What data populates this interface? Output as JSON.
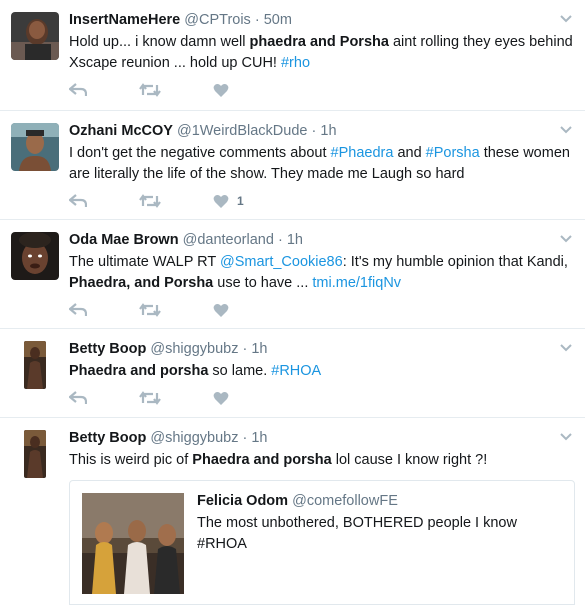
{
  "colors": {
    "link": "#1b95e0",
    "muted": "#657786",
    "text": "#14171a",
    "icon": "#aab8c2",
    "divider": "#e6ecf0"
  },
  "tweets": [
    {
      "name": "InsertNameHere",
      "handle": "@CPTrois",
      "sep": "·",
      "time": "50m",
      "text": {
        "a": "Hold up... i know damn well ",
        "b1": "phaedra and Porsha",
        "c": " aint rolling they eyes behind Xscape reunion ... hold up CUH! ",
        "tag": "#rho"
      },
      "like_count": ""
    },
    {
      "name": "Ozhani McCOY",
      "handle": "@1WeirdBlackDude",
      "sep": "·",
      "time": "1h",
      "text": {
        "a": "I don't get the negative comments about ",
        "tag1": "#Phaedra",
        "b": " and ",
        "tag2": "#Porsha",
        "c": " these women are literally the life of the show. They made me Laugh so hard"
      },
      "like_count": "1"
    },
    {
      "name": "Oda Mae Brown",
      "handle": "@danteorland",
      "sep": "·",
      "time": "1h",
      "text": {
        "a": "The ultimate WALP RT ",
        "mention": "@Smart_Cookie86",
        "b": ": It's my humble opinion that Kandi, ",
        "b1": "Phaedra, and Porsha",
        "c": " use to have ... ",
        "url": "tmi.me/1fiqNv"
      },
      "like_count": ""
    },
    {
      "name": "Betty Boop",
      "handle": "@shiggybubz",
      "sep": "·",
      "time": "1h",
      "text": {
        "b1": "Phaedra and porsha",
        "a": " so lame. ",
        "tag": "#RHOA"
      },
      "like_count": ""
    },
    {
      "name": "Betty Boop",
      "handle": "@shiggybubz",
      "sep": "·",
      "time": "1h",
      "text": {
        "a": "This is weird pic of ",
        "b1": "Phaedra and porsha",
        "c": " lol cause I know right ?!"
      },
      "quote": {
        "name": "Felicia Odom",
        "handle": "@comefollowFE",
        "text": "The most unbothered, BOTHERED people I know #RHOA"
      }
    }
  ],
  "icons": {
    "reply": "reply-icon",
    "retweet": "retweet-icon",
    "like": "heart-icon",
    "caret": "chevron-down-icon"
  }
}
